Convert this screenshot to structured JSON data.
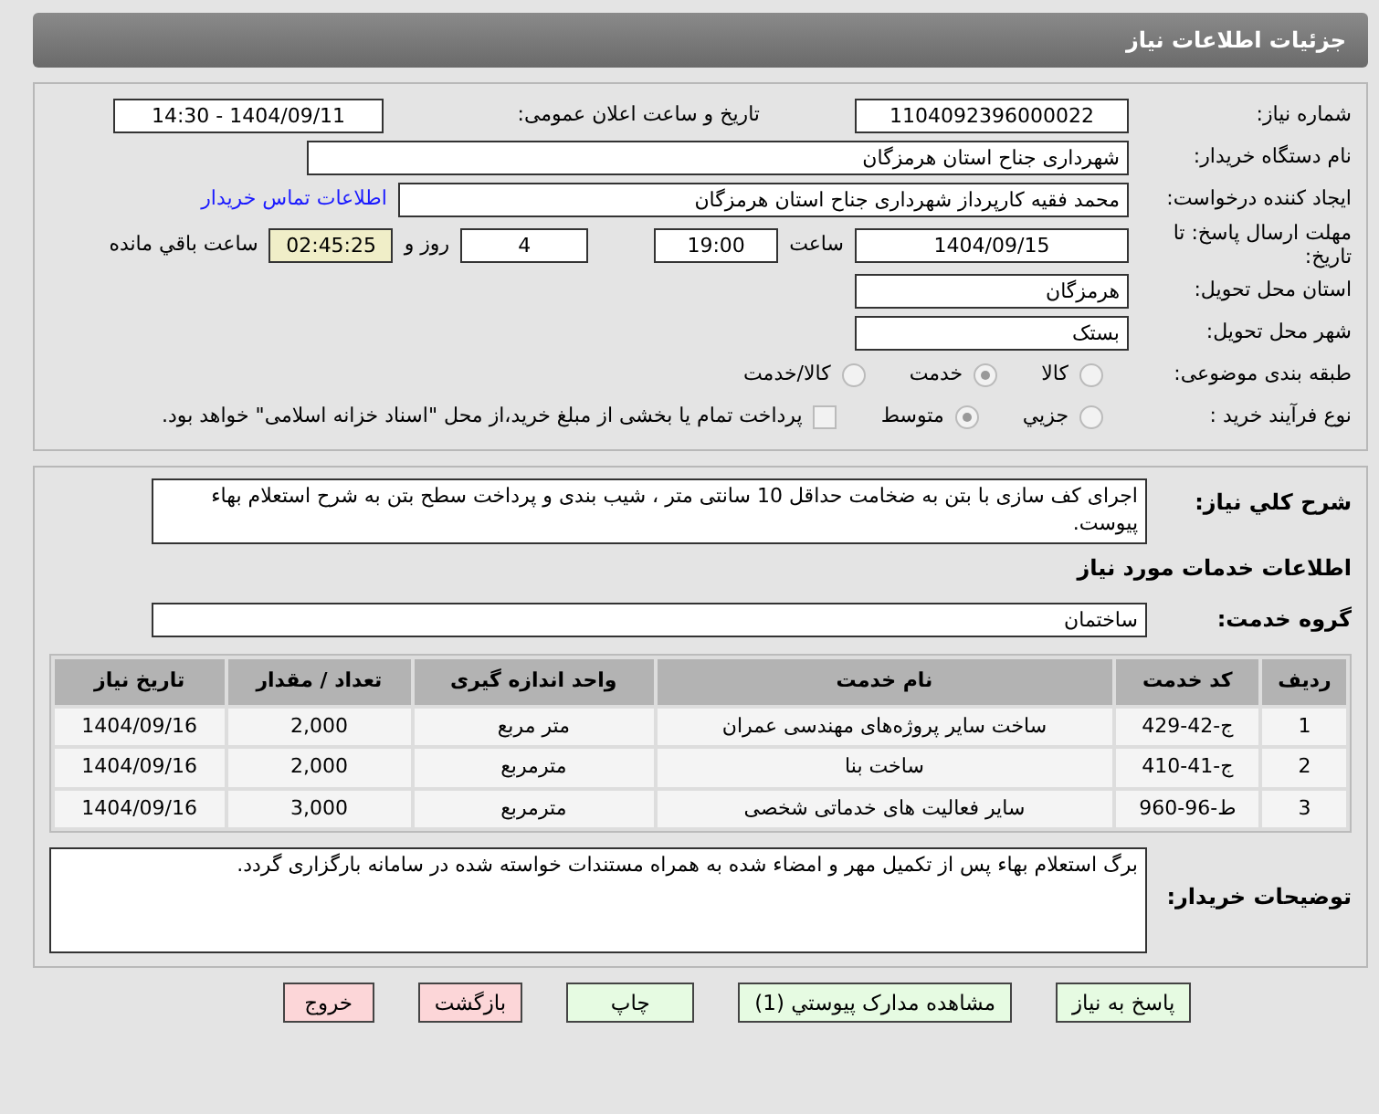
{
  "header": {
    "title": "جزئیات اطلاعات نیاز"
  },
  "need_number": {
    "label": "شماره نیاز:",
    "value": "1104092396000022"
  },
  "announce": {
    "label": "تاریخ و ساعت اعلان عمومی:",
    "value": "1404/09/11 - 14:30"
  },
  "buyer_org": {
    "label": "نام دستگاه خریدار:",
    "value": "شهرداری جناح استان هرمزگان"
  },
  "creator": {
    "label": "ایجاد کننده درخواست:",
    "value": "محمد فقیه کارپرداز شهرداری جناح استان هرمزگان",
    "link": "اطلاعات تماس خریدار"
  },
  "deadline": {
    "label": "مهلت ارسال پاسخ: تا تاریخ:",
    "date": "1404/09/15",
    "time_label": "ساعت",
    "time": "19:00",
    "days": "4",
    "days_label": "روز و",
    "remaining": "02:45:25",
    "remaining_label": "ساعت باقي مانده"
  },
  "province": {
    "label": "استان محل تحویل:",
    "value": "هرمزگان"
  },
  "city": {
    "label": "شهر محل تحویل:",
    "value": "بستک"
  },
  "category": {
    "label": "طبقه بندی موضوعی:",
    "options": [
      {
        "label": "کالا",
        "selected": false
      },
      {
        "label": "خدمت",
        "selected": true
      },
      {
        "label": "کالا/خدمت",
        "selected": false
      }
    ]
  },
  "purchase_type": {
    "label": "نوع فرآیند خرید :",
    "options": [
      {
        "label": "جزيي",
        "selected": false
      },
      {
        "label": "متوسط",
        "selected": true
      }
    ],
    "payment_checkbox": {
      "checked": false,
      "label": "پرداخت تمام یا بخشی از مبلغ خرید،از محل \"اسناد خزانه اسلامی\" خواهد بود."
    }
  },
  "description": {
    "label": "شرح کلي نیاز:",
    "value": "اجرای کف سازی با بتن به ضخامت حداقل 10 سانتی متر ، شیب بندی و پرداخت سطح بتن به شرح استعلام بهاء پیوست."
  },
  "services_heading": "اطلاعات خدمات مورد نیاز",
  "service_group": {
    "label": "گروه خدمت:",
    "value": "ساختمان"
  },
  "table": {
    "columns": [
      "ردیف",
      "کد خدمت",
      "نام خدمت",
      "واحد اندازه گیری",
      "تعداد / مقدار",
      "تاریخ نیاز"
    ],
    "rows": [
      [
        "1",
        "ج-42-429",
        "ساخت سایر پروژه‌های مهندسی عمران",
        "متر مربع",
        "2,000",
        "1404/09/16"
      ],
      [
        "2",
        "ج-41-410",
        "ساخت بنا",
        "مترمربع",
        "2,000",
        "1404/09/16"
      ],
      [
        "3",
        "ط-96-960",
        "سایر فعالیت های خدماتی شخصی",
        "مترمربع",
        "3,000",
        "1404/09/16"
      ]
    ]
  },
  "buyer_notes": {
    "label": "توضیحات خریدار:",
    "value": "برگ استعلام بهاء پس از تکمیل مهر و امضاء شده به همراه مستندات خواسته شده در سامانه بارگزاری گردد."
  },
  "buttons": [
    {
      "label": "پاسخ به نیاز",
      "kind": "go"
    },
    {
      "label": "مشاهده مدارک پیوستي (1)",
      "kind": "go"
    },
    {
      "label": "چاپ",
      "kind": "go"
    },
    {
      "label": "بازگشت",
      "kind": "stop"
    },
    {
      "label": "خروج",
      "kind": "stop"
    }
  ]
}
